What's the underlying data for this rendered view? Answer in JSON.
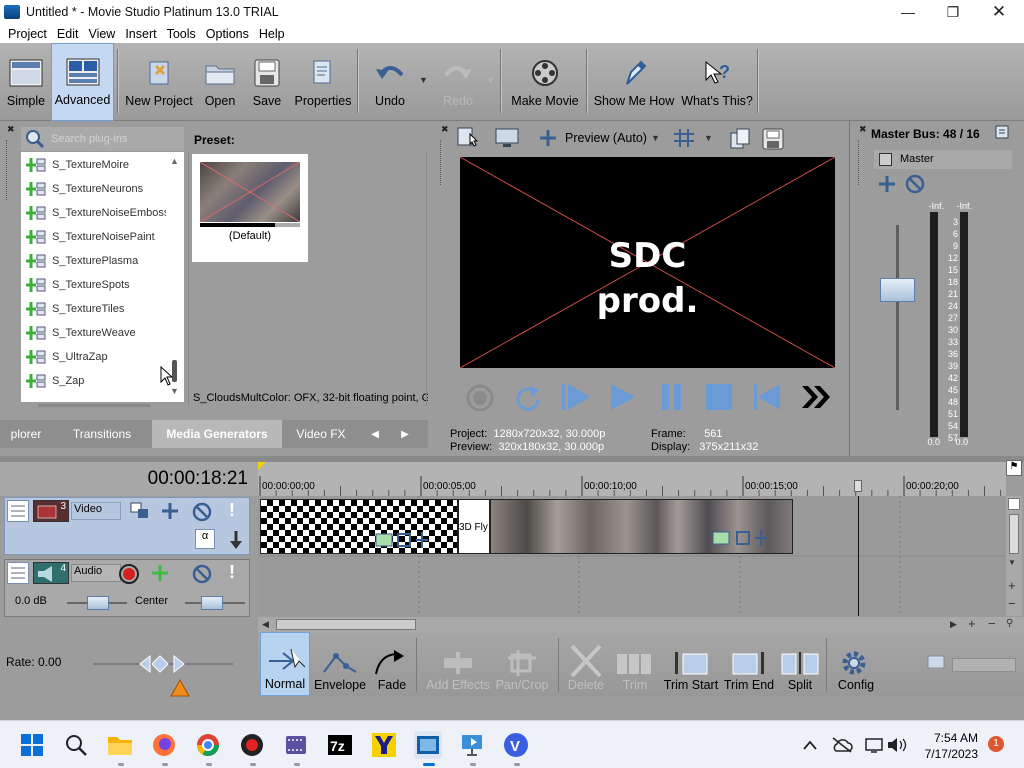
{
  "titlebar": {
    "title": "Untitled * - Movie Studio Platinum 13.0 TRIAL"
  },
  "menu": [
    "Project",
    "Edit",
    "View",
    "Insert",
    "Tools",
    "Options",
    "Help"
  ],
  "toolbar": {
    "simple": "Simple",
    "advanced": "Advanced",
    "new_project": "New Project",
    "open": "Open",
    "save": "Save",
    "properties": "Properties",
    "undo": "Undo",
    "redo": "Redo",
    "make_movie": "Make Movie",
    "show_me_how": "Show Me How",
    "whats_this": "What's This?"
  },
  "plugins": {
    "search_placeholder": "Search plug-ins",
    "items": [
      "S_TextureMoire",
      "S_TextureNeurons",
      "S_TextureNoiseEmboss",
      "S_TextureNoisePaint",
      "S_TexturePlasma",
      "S_TextureSpots",
      "S_TextureTiles",
      "S_TextureWeave",
      "S_UltraZap",
      "S_Zap"
    ],
    "preset_label": "Preset:",
    "preset_default": "(Default)",
    "status": "S_CloudsMultColor: OFX, 32-bit floating point, G"
  },
  "tabs": [
    "plorer",
    "Transitions",
    "Media Generators",
    "Video FX"
  ],
  "preview": {
    "mode": "Preview (Auto)",
    "text_line1": "SDC",
    "text_line2": "prod.",
    "project_label": "Project:",
    "project_value": "1280x720x32, 30.000p",
    "preview_label": "Preview:",
    "preview_value": "320x180x32, 30.000p",
    "frame_label": "Frame:",
    "frame_value": "561",
    "display_label": "Display:",
    "display_value": "375x211x32"
  },
  "master": {
    "title": "Master Bus: 48 / 16",
    "name": "Master",
    "inf_left": "-Inf.",
    "inf_right": "-Inf.",
    "scale": [
      "3",
      "6",
      "9",
      "12",
      "15",
      "18",
      "21",
      "24",
      "27",
      "30",
      "33",
      "36",
      "39",
      "42",
      "45",
      "48",
      "51",
      "54",
      "57"
    ],
    "zero_left": "0.0",
    "zero_right": "0.0"
  },
  "timeline": {
    "timecode": "00:00:18:21",
    "ruler": [
      "00:00:00;00",
      "00:00:05;00",
      "00:00:10;00",
      "00:00:15;00",
      "00:00:20;00"
    ],
    "video_track": {
      "number": "3",
      "name": "Video"
    },
    "audio_track": {
      "number": "4",
      "name": "Audio",
      "volume": "0.0 dB",
      "pan": "Center"
    },
    "clip_label": "3D Fly",
    "rate": "Rate: 0.00"
  },
  "edit_tools": {
    "normal": "Normal",
    "envelope": "Envelope",
    "fade": "Fade",
    "add_effects": "Add Effects",
    "pan_crop": "Pan/Crop",
    "delete": "Delete",
    "trim": "Trim",
    "trim_start": "Trim Start",
    "trim_end": "Trim End",
    "split": "Split",
    "config": "Config"
  },
  "taskbar": {
    "time": "7:54 AM",
    "date": "7/17/2023",
    "notification_count": "1",
    "app_labels": {
      "sevenzip": "7z",
      "vpn": "V"
    }
  }
}
